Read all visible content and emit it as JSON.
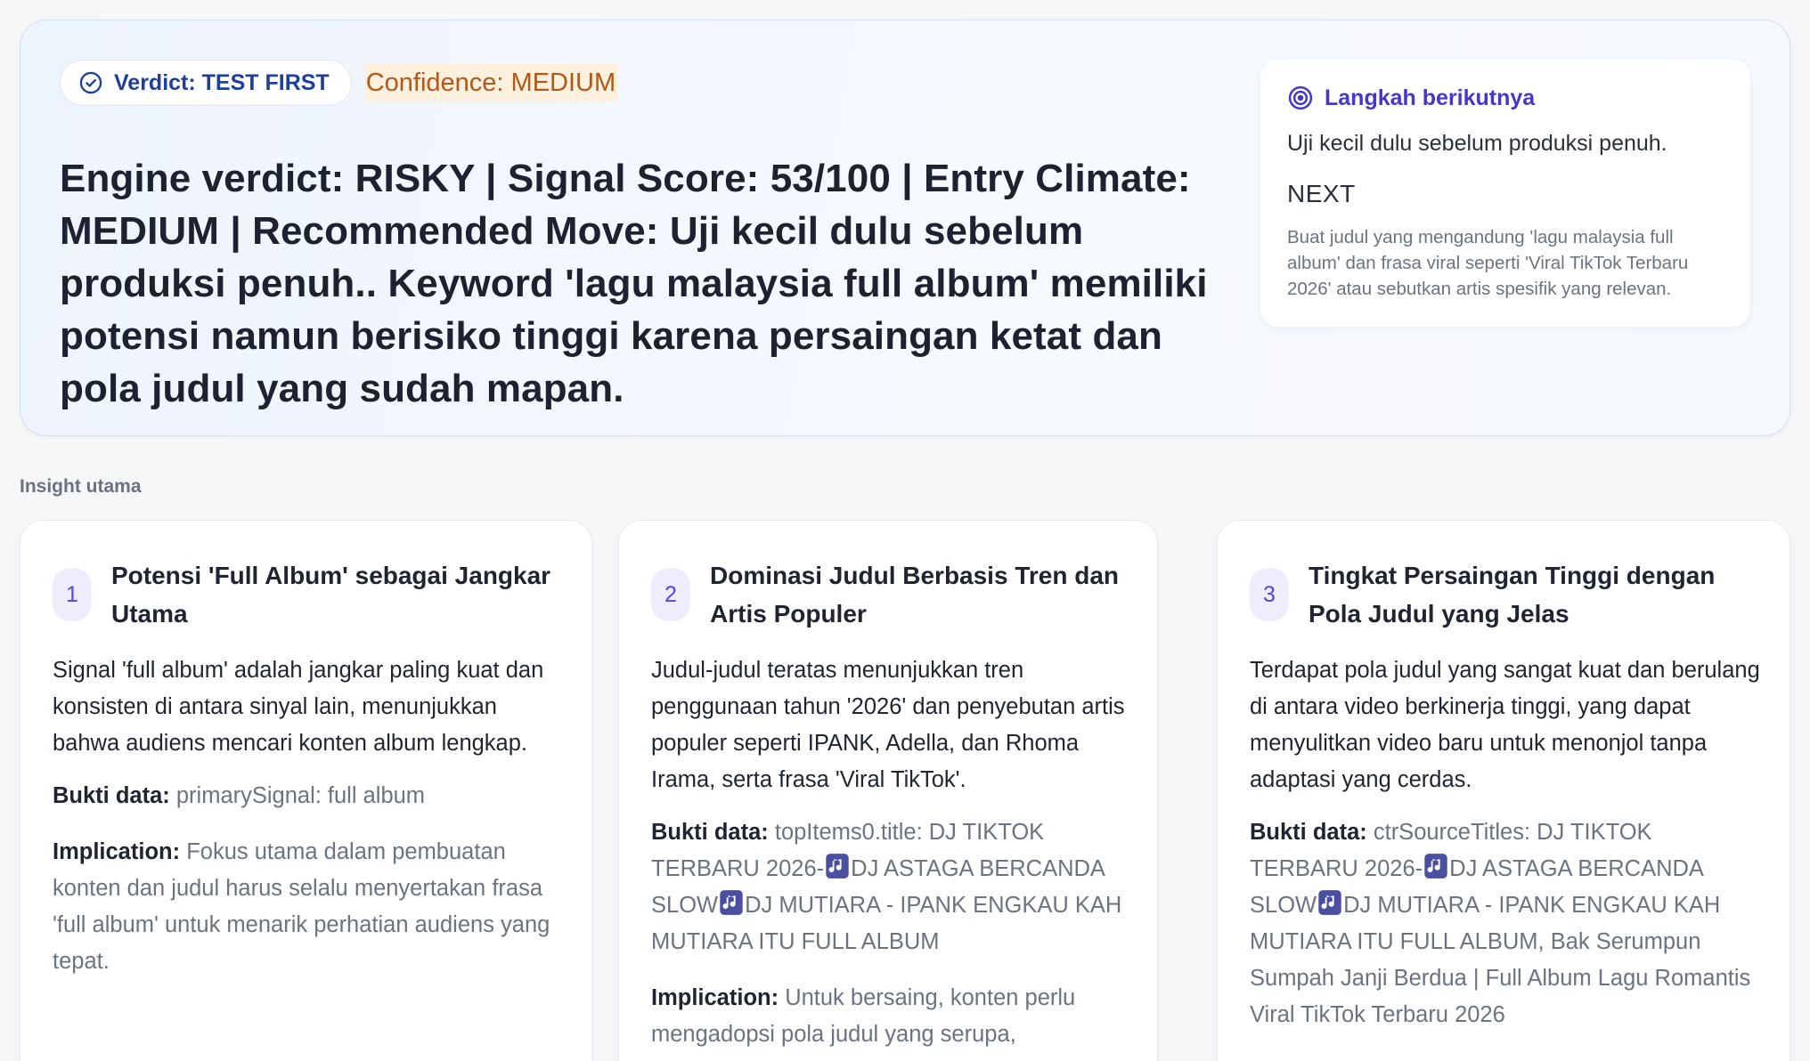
{
  "verdict": {
    "badge_label": "Verdict: TEST FIRST",
    "confidence": "Confidence: MEDIUM",
    "headline": "Engine verdict: RISKY | Signal Score: 53/100 | Entry Climate: MEDIUM | Recommended Move: Uji kecil dulu sebelum produksi penuh.. Keyword 'lagu malaysia full album' memiliki potensi namun berisiko tinggi karena persaingan ketat dan pola judul yang sudah mapan."
  },
  "next_step": {
    "title": "Langkah berikutnya",
    "subtitle": "Uji kecil dulu sebelum produksi penuh.",
    "label": "NEXT",
    "description": "Buat judul yang mengandung 'lagu malaysia full album' dan frasa viral seperti 'Viral TikTok Terbaru 2026' atau sebutkan artis spesifik yang relevan."
  },
  "insights_section": {
    "label": "Insight utama",
    "evidence_key": "Bukti data:",
    "implication_key": "Implication:",
    "cards": [
      {
        "number": "1",
        "title": "Potensi 'Full Album' sebagai Jangkar Utama",
        "description": "Signal 'full album' adalah jangkar paling kuat dan konsisten di antara sinyal lain, menunjukkan bahwa audiens mencari konten album lengkap.",
        "evidence": "primarySignal: full album",
        "implication": "Fokus utama dalam pembuatan konten dan judul harus selalu menyertakan frasa 'full album' untuk menarik perhatian audiens yang tepat."
      },
      {
        "number": "2",
        "title": "Dominasi Judul Berbasis Tren dan Artis Populer",
        "description": "Judul-judul teratas menunjukkan tren penggunaan tahun '2026' dan penyebutan artis populer seperti IPANK, Adella, dan Rhoma Irama, serta frasa 'Viral TikTok'.",
        "evidence_parts": [
          "topItems0.title: DJ TIKTOK TERBARU 2026-",
          "DJ ASTAGA BERCANDA SLOW",
          "DJ MUTIARA - IPANK ENGKAU KAH MUTIARA ITU FULL ALBUM"
        ],
        "implication": "Untuk bersaing, konten perlu mengadopsi pola judul yang serupa,"
      },
      {
        "number": "3",
        "title": "Tingkat Persaingan Tinggi dengan Pola Judul yang Jelas",
        "description": "Terdapat pola judul yang sangat kuat dan berulang di antara video berkinerja tinggi, yang dapat menyulitkan video baru untuk menonjol tanpa adaptasi yang cerdas.",
        "evidence_parts": [
          "ctrSourceTitles: DJ TIKTOK TERBARU 2026-",
          "DJ ASTAGA BERCANDA SLOW",
          "DJ MUTIARA - IPANK ENGKAU KAH MUTIARA ITU FULL ALBUM, Bak Serumpun Sumpah Janji Berdua | Full Album Lagu Romantis Viral TikTok Terbaru 2026"
        ]
      }
    ]
  },
  "colors": {
    "accent": "#4338ca",
    "verdict_text": "#1e3f9a",
    "confidence_text": "#b1581a",
    "confidence_bg": "#fdf1de",
    "muted": "#6b7380"
  },
  "icons": {
    "verdict": "check-circle-icon",
    "next_step": "target-icon",
    "inline_note": "music-note-icon"
  }
}
